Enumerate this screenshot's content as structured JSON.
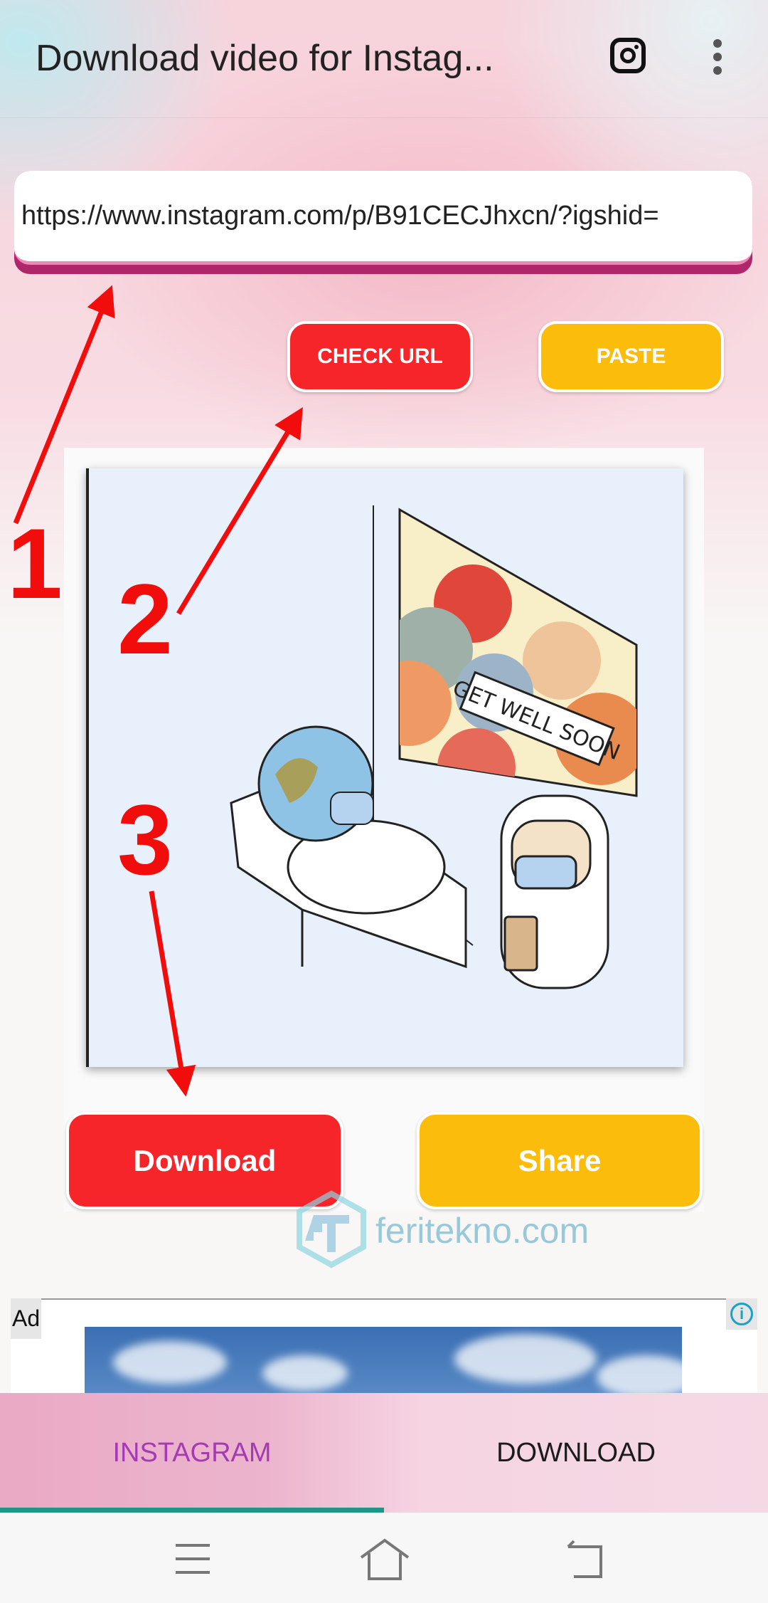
{
  "header": {
    "title": "Download video for Instag...",
    "instagram_icon": "instagram-icon",
    "menu_icon": "more-vert-icon"
  },
  "url_input": {
    "value": "https://www.instagram.com/p/B91CECJhxcn/?igshid="
  },
  "buttons": {
    "check_url": "CHECK URL",
    "paste": "PASTE",
    "download": "Download",
    "share": "Share"
  },
  "colors": {
    "red": "#f62529",
    "yellow": "#fbbc0c",
    "tab_active": "#a23bb4",
    "indicator": "#1f9687",
    "underline": "#b0266a"
  },
  "preview": {
    "sign_text": "GET WELL SOON"
  },
  "watermark": {
    "text": "feritekno.com",
    "logo": "FT"
  },
  "ad": {
    "label": "Ad",
    "info_icon": "info-icon"
  },
  "tabs": [
    {
      "label": "INSTAGRAM",
      "active": true
    },
    {
      "label": "DOWNLOAD",
      "active": false
    }
  ],
  "annotations": {
    "step1": "1",
    "step2": "2",
    "step3": "3"
  },
  "nav": {
    "menu": "menu-icon",
    "home": "home-icon",
    "back": "back-icon"
  }
}
